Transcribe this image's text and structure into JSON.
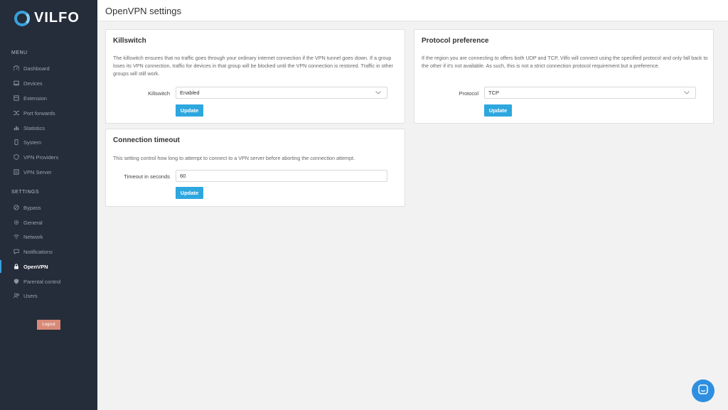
{
  "brand": {
    "name": "VILFO"
  },
  "sidebar": {
    "menu_title": "MENU",
    "menu_items": [
      {
        "label": "Dashboard",
        "icon": "dashboard-icon"
      },
      {
        "label": "Devices",
        "icon": "devices-icon"
      },
      {
        "label": "Extension",
        "icon": "extension-icon"
      },
      {
        "label": "Port forwards",
        "icon": "shuffle-icon"
      },
      {
        "label": "Statistics",
        "icon": "statistics-icon"
      },
      {
        "label": "System",
        "icon": "system-icon"
      },
      {
        "label": "VPN Providers",
        "icon": "vpn-providers-icon"
      },
      {
        "label": "VPN Server",
        "icon": "server-icon"
      }
    ],
    "settings_title": "SETTINGS",
    "settings_items": [
      {
        "label": "Bypass",
        "icon": "bypass-icon"
      },
      {
        "label": "General",
        "icon": "gear-icon"
      },
      {
        "label": "Network",
        "icon": "wifi-icon"
      },
      {
        "label": "Notifications",
        "icon": "chat-bubble-icon"
      },
      {
        "label": "OpenVPN",
        "icon": "lock-icon",
        "active": true
      },
      {
        "label": "Parental control",
        "icon": "shield-icon"
      },
      {
        "label": "Users",
        "icon": "users-icon"
      }
    ],
    "logout_label": "Logout"
  },
  "header": {
    "title": "OpenVPN settings"
  },
  "killswitch": {
    "title": "Killswitch",
    "description": "The killswitch ensures that no traffic goes through your ordinary internet connection if the VPN tunnel goes down. If a group loses its VPN connection, traffic for devices in that group will be blocked until the VPN connection is restored. Traffic in other groups will still work.",
    "field_label": "Killswitch",
    "value": "Enabled",
    "button_label": "Update"
  },
  "protocol": {
    "title": "Protocol preference",
    "description": "If the region you are connecting to offers both UDP and TCP, Vilfo will connect using the specified protocol and only fall back to the other if it's not available. As such, this is not a strict connection protocol requirement but a preference.",
    "field_label": "Protocol",
    "value": "TCP",
    "button_label": "Update"
  },
  "timeout": {
    "title": "Connection timeout",
    "description": "This setting control how long to attempt to connect to a VPN server before aborting the connection attempt.",
    "field_label": "Timeout in seconds",
    "value": "60",
    "button_label": "Update"
  },
  "colors": {
    "sidebar_bg": "#252c3a",
    "accent": "#2ea7df",
    "logout": "#d88a78",
    "chat": "#2e8fe0"
  }
}
